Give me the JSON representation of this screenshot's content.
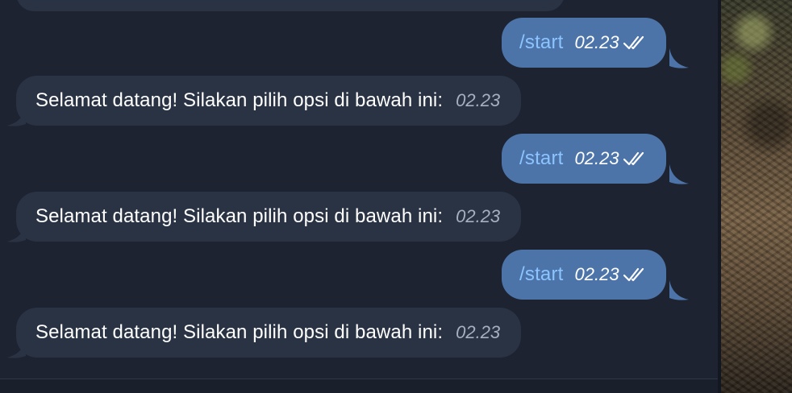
{
  "messages": [
    {
      "direction": "out",
      "text": "/start",
      "time": "02.23",
      "status_icon": "double-check-icon"
    },
    {
      "direction": "in",
      "text": "Selamat datang! Silakan pilih opsi di bawah ini:",
      "time": "02.23"
    },
    {
      "direction": "out",
      "text": "/start",
      "time": "02.23",
      "status_icon": "double-check-icon"
    },
    {
      "direction": "in",
      "text": "Selamat datang! Silakan pilih opsi di bawah ini:",
      "time": "02.23"
    },
    {
      "direction": "out",
      "text": "/start",
      "time": "02.23",
      "status_icon": "double-check-icon"
    },
    {
      "direction": "in",
      "text": "Selamat datang! Silakan pilih opsi di bawah ini:",
      "time": "02.23"
    }
  ],
  "colors": {
    "chat_background": "#1d2330",
    "outgoing_bubble": "#4d74a8",
    "incoming_bubble": "#2a3344",
    "command_link": "#8cc4ff"
  }
}
